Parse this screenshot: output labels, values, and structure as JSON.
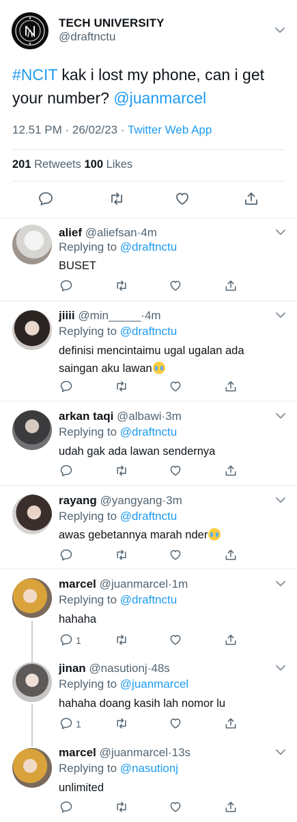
{
  "main": {
    "account_name": "TECH UNIVERSITY",
    "handle": "@draftnctu",
    "hashtag": "#NCIT",
    "text_line1": " kak i lost my phone, can i get",
    "text_line2": "your number? ",
    "mention": "@juanmarcel",
    "time": "12.51 PM · 26/02/23 · ",
    "source": "Twitter Web App",
    "retweets_count": "201",
    "retweets_label": " Retweets ",
    "likes_count": "100",
    "likes_label": " Likes"
  },
  "replies": [
    {
      "name": "alief",
      "handle": "@aliefsan",
      "time": "·4m",
      "replying_label": "Replying to ",
      "replying_to": "@draftnctu",
      "text": "BUSET",
      "reply_count": ""
    },
    {
      "name": "jiiii",
      "handle": "@min_____",
      "time": "·4m",
      "replying_label": "Replying to ",
      "replying_to": "@draftnctu",
      "text_line1": "definisi mencintaimu ugal ugalan ada",
      "text_line2": "saingan aku lawan",
      "emoji": "loudly-crying-face",
      "reply_count": ""
    },
    {
      "name": "arkan taqi",
      "handle": "@albawi",
      "time": "·3m",
      "replying_label": "Replying to ",
      "replying_to": "@draftnctu",
      "text": "udah gak ada lawan sendernya",
      "reply_count": ""
    },
    {
      "name": "rayang",
      "handle": "@yangyang",
      "time": "·3m",
      "replying_label": "Replying to ",
      "replying_to": "@draftnctu",
      "text": "awas gebetannya marah nder",
      "emoji": "face-with-tears-of-joy",
      "reply_count": ""
    },
    {
      "name": "marcel",
      "handle": "@juanmarcel",
      "time": "·1m",
      "replying_label": "Replying to ",
      "replying_to": "@draftnctu",
      "text": "hahaha",
      "reply_count": "1"
    },
    {
      "name": "jinan",
      "handle": "@nasutionj",
      "time": "·48s",
      "replying_label": "Replying to ",
      "replying_to": "@juanmarcel",
      "text": "hahaha doang kasih lah nomor lu",
      "reply_count": "1"
    },
    {
      "name": "marcel",
      "handle": "@juanmarcel",
      "time": "·13s",
      "replying_label": "Replying to ",
      "replying_to": "@nasutionj",
      "text": "unlimited",
      "reply_count": ""
    }
  ],
  "colors": {
    "accent": "#1d9bf0",
    "secondary_text": "#536471",
    "divider": "#e5e8eb"
  }
}
